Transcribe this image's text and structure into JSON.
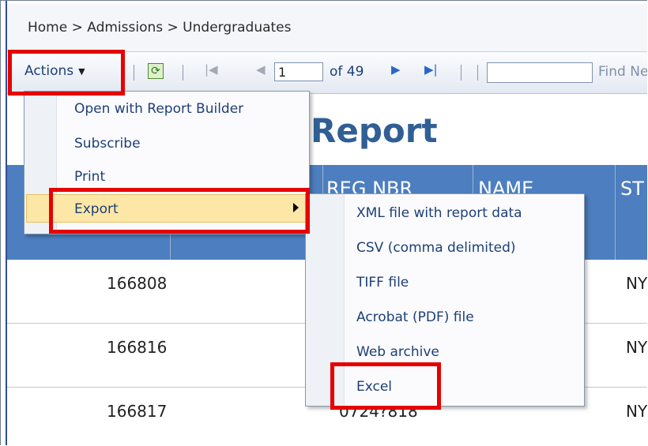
{
  "breadcrumb": "Home > Admissions > Undergraduates",
  "toolbar": {
    "actions_label": "Actions",
    "page_value": "1",
    "of_label": "of 49",
    "find_label": "Find Ne"
  },
  "report": {
    "title": "Report",
    "headers": [
      "REG NBR",
      "NAME",
      "ST"
    ],
    "rows": [
      {
        "id": "166808",
        "state": "NY"
      },
      {
        "id": "166816",
        "state": "NY"
      },
      {
        "id": "166817",
        "reg_partial": "0724?818",
        "state": "NY"
      }
    ]
  },
  "actions_menu": {
    "items": [
      "Open with Report Builder",
      "Subscribe",
      "Print",
      "Export"
    ]
  },
  "export_menu": {
    "items": [
      "XML file with report data",
      "CSV (comma delimited)",
      "TIFF file",
      "Acrobat (PDF) file",
      "Web archive",
      "Excel"
    ]
  },
  "colors": {
    "highlight": "#e60000",
    "header_blue": "#4d7ebf",
    "title_blue": "#2f5f94"
  }
}
